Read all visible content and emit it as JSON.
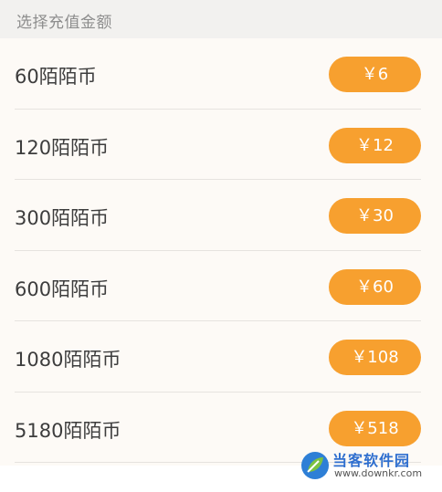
{
  "header": {
    "title": "选择充值金额"
  },
  "options": [
    {
      "label": "60陌陌币",
      "price": "￥6"
    },
    {
      "label": "120陌陌币",
      "price": "￥12"
    },
    {
      "label": "300陌陌币",
      "price": "￥30"
    },
    {
      "label": "600陌陌币",
      "price": "￥60"
    },
    {
      "label": "1080陌陌币",
      "price": "￥108"
    },
    {
      "label": "5180陌陌币",
      "price": "￥518"
    }
  ],
  "watermark": {
    "title": "当客软件园",
    "url": "www.downkr.com"
  },
  "colors": {
    "accent": "#f7a02f",
    "header_bg": "#f2f1ef",
    "list_bg": "#fdfaf6",
    "text": "#3d3d3d"
  }
}
